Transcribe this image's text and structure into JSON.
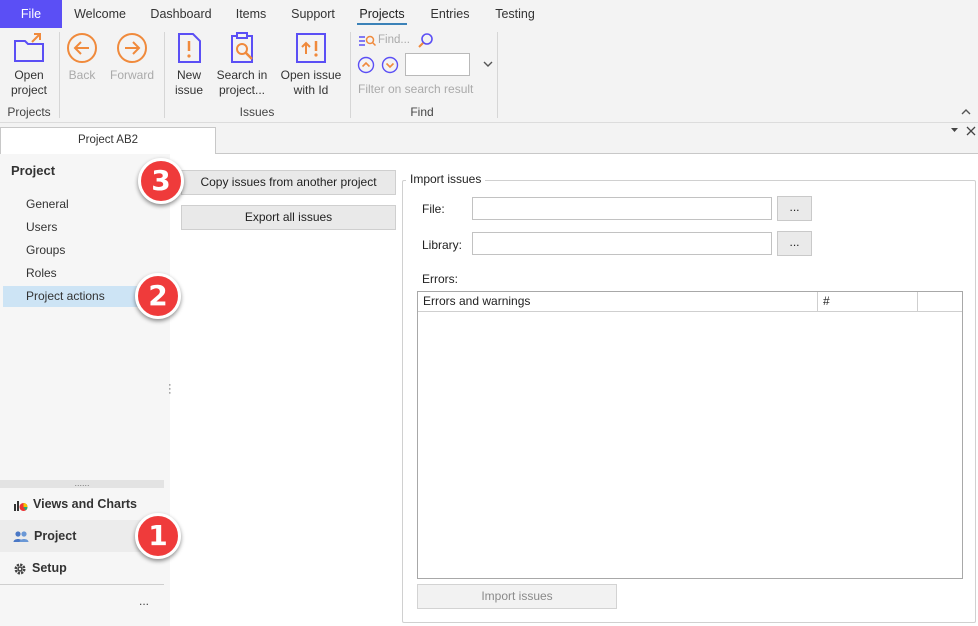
{
  "menu": {
    "tabs": [
      "File",
      "Welcome",
      "Dashboard",
      "Items",
      "Support",
      "Projects",
      "Entries",
      "Testing"
    ],
    "active": "Projects"
  },
  "ribbon": {
    "open_project": "Open\nproject",
    "open_project_l1": "Open",
    "open_project_l2": "project",
    "group_projects": "Projects",
    "back": "Back",
    "forward": "Forward",
    "new_issue_l1": "New",
    "new_issue_l2": "issue",
    "search_l1": "Search in",
    "search_l2": "project...",
    "open_id_l1": "Open issue",
    "open_id_l2": "with Id",
    "group_issues": "Issues",
    "find_placeholder": "Find...",
    "filter_label": "Filter on search result",
    "group_find": "Find"
  },
  "doc_tab": {
    "title": "Project AB2"
  },
  "nav": {
    "heading": "Project",
    "items": [
      "General",
      "Users",
      "Groups",
      "Roles",
      "Project actions"
    ],
    "selected": "Project actions",
    "grip": "......",
    "bottom": [
      "Views and Charts",
      "Project",
      "Setup"
    ],
    "more": "..."
  },
  "actions": {
    "copy": "Copy issues from another project",
    "export": "Export all issues"
  },
  "import": {
    "legend": "Import issues",
    "file_label": "File:",
    "library_label": "Library:",
    "browse": "...",
    "errors_label": "Errors:",
    "columns": [
      "Errors and warnings",
      "#",
      ""
    ],
    "button": "Import issues"
  },
  "badges": [
    "1",
    "2",
    "3"
  ],
  "colors": {
    "file_tab": "#5b4ff5",
    "accent": "#5b4ff5",
    "selection": "#cde4f5",
    "badge": "#ef3b3b"
  }
}
